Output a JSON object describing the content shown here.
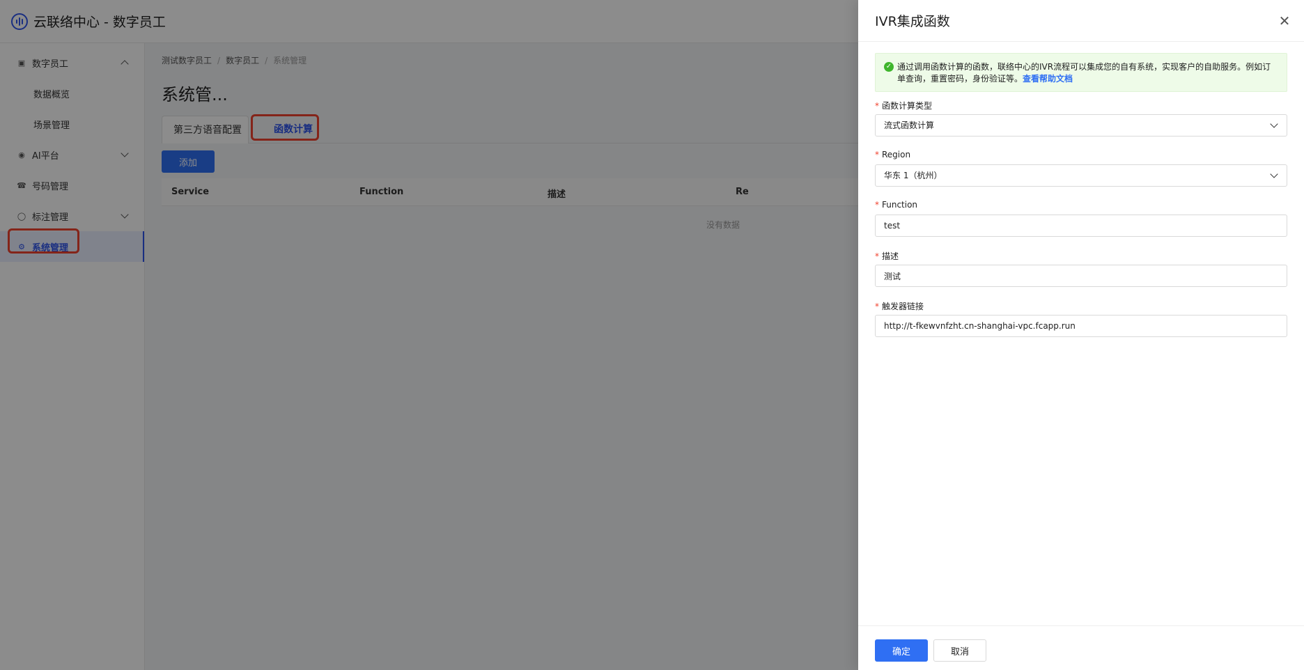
{
  "app": {
    "title": "云联络中心 - 数字员工",
    "logo_icon": "soundwave-logo-icon"
  },
  "sidebar": {
    "items": [
      {
        "label": "数字员工",
        "icon": "robot-icon",
        "expanded": true
      },
      {
        "label": "数据概览"
      },
      {
        "label": "场景管理"
      },
      {
        "label": "AI平台",
        "icon": "eye-icon",
        "expanded": false
      },
      {
        "label": "号码管理",
        "icon": "phone-icon"
      },
      {
        "label": "标注管理",
        "icon": "tag-icon",
        "expanded": false
      },
      {
        "label": "系统管理",
        "icon": "gear-icon",
        "active": true
      }
    ]
  },
  "breadcrumb": [
    "测试数字员工",
    "数字员工",
    "系统管理"
  ],
  "page": {
    "title": "系统管..."
  },
  "tabs": [
    {
      "label": "第三方语音配置"
    },
    {
      "label": "函数计算",
      "active": true
    }
  ],
  "toolbar": {
    "add_label": "添加"
  },
  "table": {
    "columns": [
      "Service",
      "Function",
      "描述",
      "Re"
    ],
    "empty_text": "没有数据"
  },
  "drawer": {
    "title": "IVR集成函数",
    "close_icon": "close-icon",
    "alert": {
      "text": "通过调用函数计算的函数，联络中心的IVR流程可以集成您的自有系统，实现客户的自助服务。例如订单查询，重置密码，身份验证等。",
      "link": "查看帮助文档"
    },
    "fields": {
      "type": {
        "label": "函数计算类型",
        "value": "流式函数计算"
      },
      "region": {
        "label": "Region",
        "value": "华东 1（杭州）"
      },
      "function": {
        "label": "Function",
        "value": "test"
      },
      "desc": {
        "label": "描述",
        "value": "测试"
      },
      "trigger": {
        "label": "触发器链接",
        "value": "http://t-fkewvnfzht.cn-shanghai-vpc.fcapp.run"
      }
    },
    "required_mark": "*",
    "ok_label": "确定",
    "cancel_label": "取消"
  },
  "colors": {
    "accent": "#2f6ff3",
    "highlight": "#f0422f",
    "success": "#3fb52d"
  }
}
